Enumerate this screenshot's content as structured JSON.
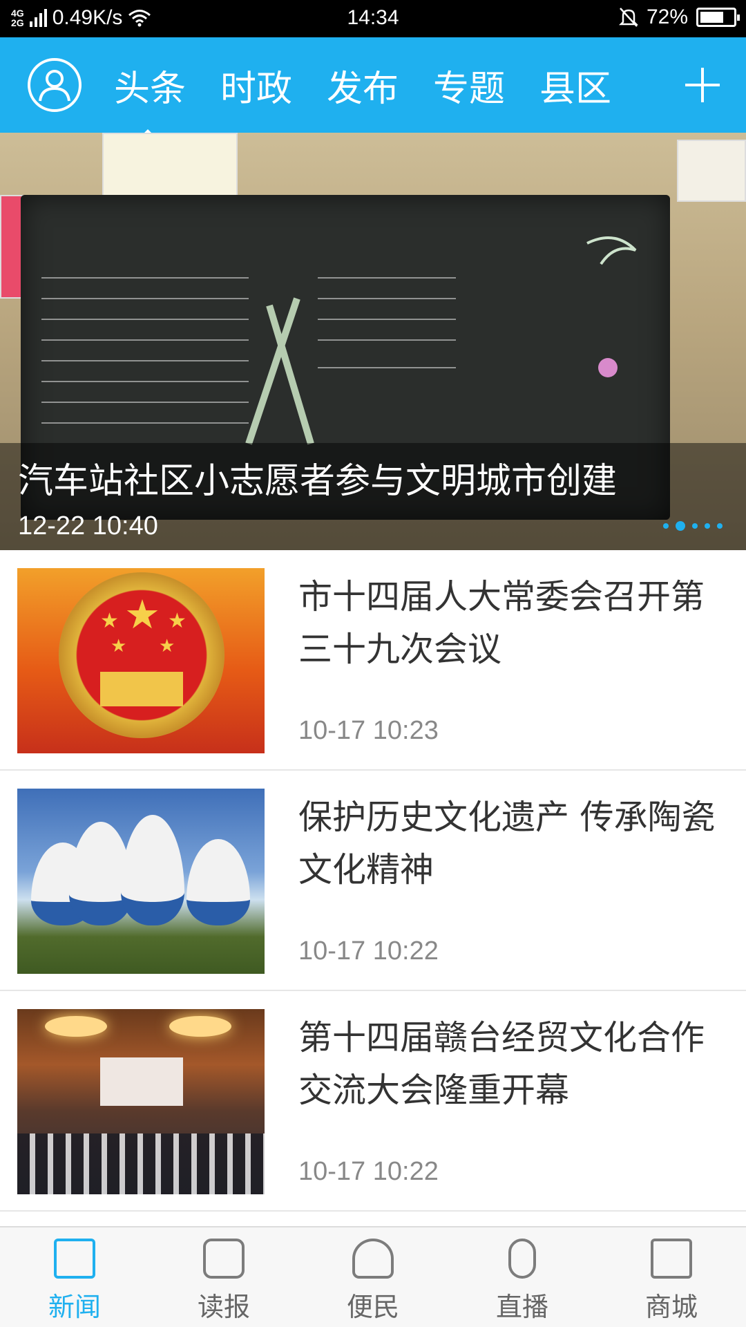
{
  "status_bar": {
    "network_top": "4G",
    "network_bottom": "2G",
    "speed": "0.49K/s",
    "time": "14:34",
    "battery": "72%",
    "battery_level": 0.72
  },
  "header": {
    "tabs": [
      "头条",
      "时政",
      "发布",
      "专题",
      "县区"
    ],
    "active_tab": "头条",
    "accent_color": "#1fb0ef"
  },
  "hero": {
    "title": "汽车站社区小志愿者参与文明城市创建",
    "time": "12-22 10:40",
    "slide_count": 5,
    "active_slide": 2
  },
  "news": [
    {
      "title": "市十四届人大常委会召开第三十九次会议",
      "time": "10-17 10:23"
    },
    {
      "title": "保护历史文化遗产 传承陶瓷文化精神",
      "time": "10-17 10:22"
    },
    {
      "title": "第十四届赣台经贸文化合作交流大会隆重开幕",
      "time": "10-17 10:22"
    }
  ],
  "bottom_nav": {
    "items": [
      "新闻",
      "读报",
      "便民",
      "直播",
      "商城"
    ],
    "active": "新闻"
  }
}
